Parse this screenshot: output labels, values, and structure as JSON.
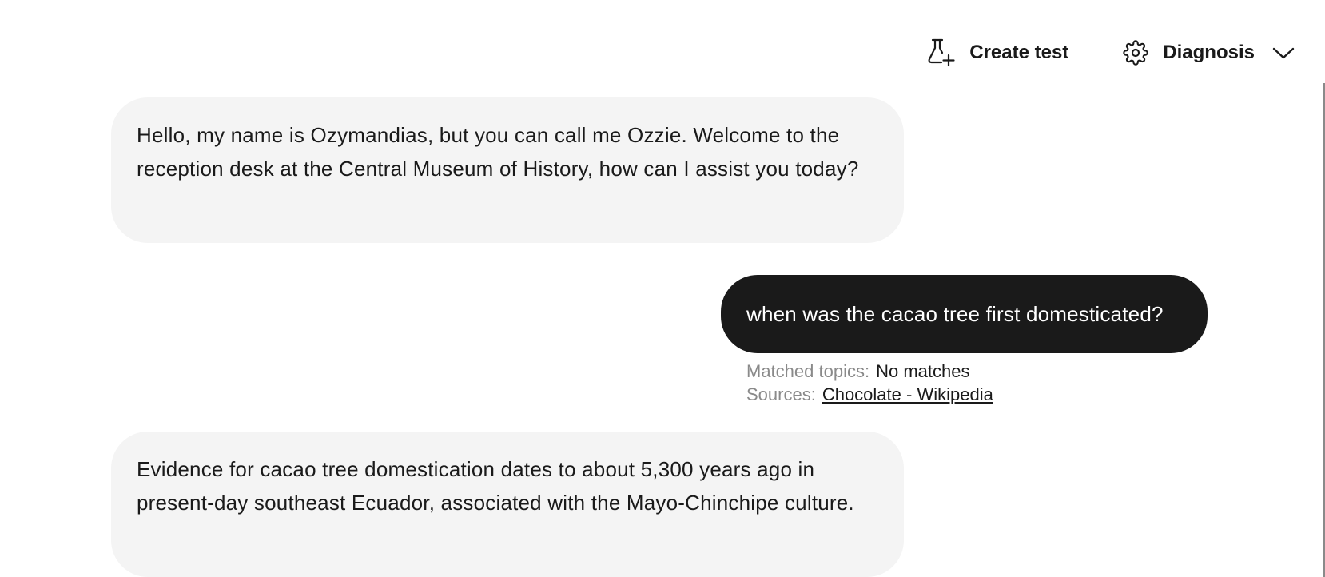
{
  "toolbar": {
    "create_test_label": "Create test",
    "create_test_icon": "flask-plus-icon",
    "diagnosis_label": "Diagnosis",
    "diagnosis_icon": "gear-icon",
    "diagnosis_dropdown_icon": "chevron-down-icon"
  },
  "conversation": {
    "messages": [
      {
        "role": "bot",
        "text": "Hello, my name is Ozymandias, but you can call me Ozzie. Welcome to the reception desk at the Central Museum of History, how can I assist you today?"
      },
      {
        "role": "user",
        "text": "when was the cacao tree first domesticated?",
        "matched_topics_label": "Matched topics:",
        "matched_topics_value": "No matches",
        "sources_label": "Sources:",
        "sources_link": "Chocolate - Wikipedia"
      },
      {
        "role": "bot",
        "text": "Evidence for cacao tree domestication dates to about 5,300 years ago in present-day southeast Ecuador, associated with the Mayo-Chinchipe culture."
      }
    ]
  },
  "colors": {
    "bot_bubble_bg": "#f4f4f4",
    "user_bubble_bg": "#1a1a1a",
    "muted_text": "#8a8a8a"
  }
}
